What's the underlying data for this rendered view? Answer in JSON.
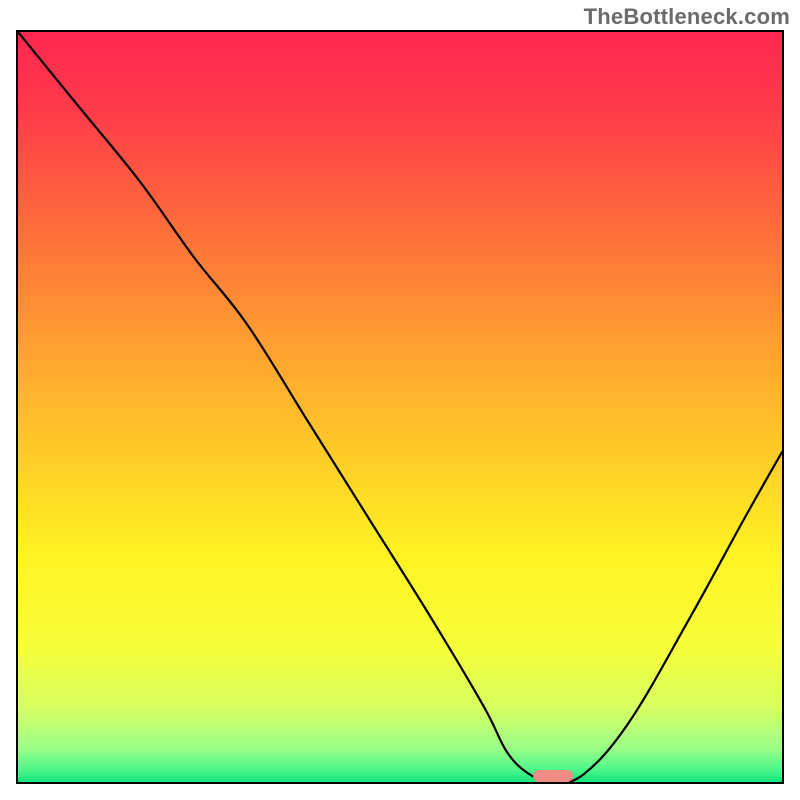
{
  "watermark": "TheBottleneck.com",
  "colors": {
    "curve": "#000000",
    "marker": "#f08b85",
    "frame_border": "#000000",
    "gradient_stops": [
      {
        "pos": 0.0,
        "color": "#ff2850"
      },
      {
        "pos": 0.1,
        "color": "#ff3a4a"
      },
      {
        "pos": 0.25,
        "color": "#ff6a3c"
      },
      {
        "pos": 0.4,
        "color": "#ff9a32"
      },
      {
        "pos": 0.55,
        "color": "#ffc828"
      },
      {
        "pos": 0.7,
        "color": "#fff423"
      },
      {
        "pos": 0.82,
        "color": "#f7ff3a"
      },
      {
        "pos": 0.9,
        "color": "#d7ff60"
      },
      {
        "pos": 0.955,
        "color": "#9cff88"
      },
      {
        "pos": 0.985,
        "color": "#48f58a"
      },
      {
        "pos": 1.0,
        "color": "#12e47a"
      }
    ]
  },
  "chart_data": {
    "type": "line",
    "title": "",
    "xlabel": "",
    "ylabel": "",
    "xlim": [
      0,
      100
    ],
    "ylim": [
      0,
      100
    ],
    "legend": false,
    "series": [
      {
        "name": "bottleneck_curve",
        "x": [
          0,
          8,
          16,
          23,
          30,
          38,
          46,
          54,
          61,
          64,
          67,
          70,
          74,
          80,
          88,
          95,
          100
        ],
        "y": [
          100,
          90,
          80,
          70,
          61,
          48,
          35,
          22,
          10,
          4,
          1,
          0,
          1,
          8,
          22,
          35,
          44
        ]
      }
    ],
    "optimal_x": 70,
    "optimal_y": 0,
    "marker_width_pct": 5.2
  }
}
